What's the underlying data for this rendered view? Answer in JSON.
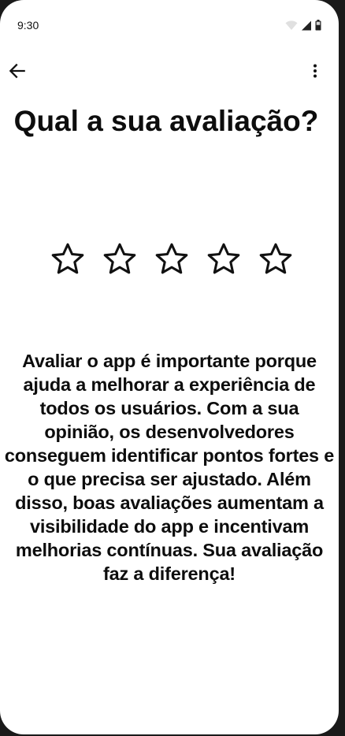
{
  "status_bar": {
    "time": "9:30",
    "icons": [
      "wifi-icon",
      "signal-icon",
      "battery-icon"
    ]
  },
  "app_bar": {
    "back_icon": "arrow-left-icon",
    "menu_icon": "more-vertical-icon"
  },
  "main": {
    "title": "Qual a sua avaliação?",
    "rating": {
      "max": 5,
      "value": 0,
      "icon": "star-outline-icon"
    },
    "description": "Avaliar o app é importante porque ajuda a melhorar a experiência de todos os usuários. Com a sua opinião, os desenvolvedores conseguem identificar pontos fortes e o que precisa ser ajustado. Além disso, boas avaliações aumentam a visibilidade do app e incentivam melhorias contínuas. Sua avaliação faz a diferença!"
  },
  "colors": {
    "background": "#ffffff",
    "text": "#0d0d0d",
    "frame": "#1a1a1a"
  }
}
